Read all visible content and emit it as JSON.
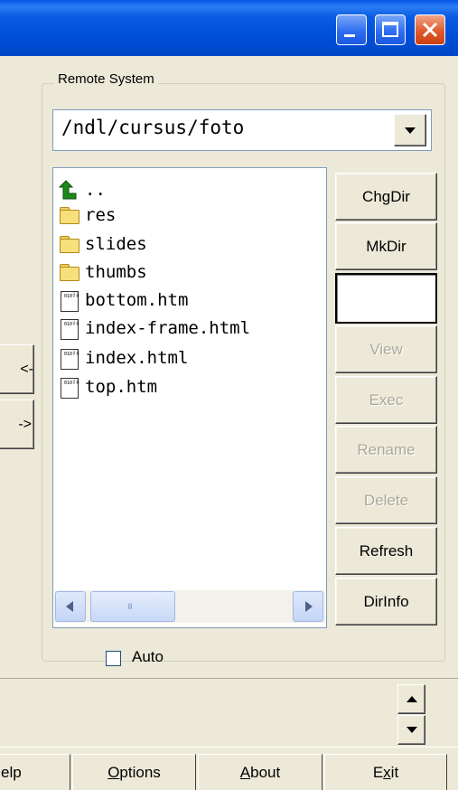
{
  "window": {
    "caption_buttons": [
      {
        "name": "minimize-icon"
      },
      {
        "name": "maximize-icon"
      },
      {
        "name": "close-icon"
      }
    ]
  },
  "remote": {
    "group_label": "Remote System",
    "path": "/ndl/cursus/foto",
    "files": [
      {
        "name": "..",
        "type": "up"
      },
      {
        "name": "res",
        "type": "folder"
      },
      {
        "name": "slides",
        "type": "folder"
      },
      {
        "name": "thumbs",
        "type": "folder"
      },
      {
        "name": "bottom.htm",
        "type": "file"
      },
      {
        "name": "index-frame.html",
        "type": "file"
      },
      {
        "name": "index.html",
        "type": "file"
      },
      {
        "name": "top.htm",
        "type": "file"
      }
    ],
    "scroll_grip": "III",
    "buttons": {
      "chgdir": "ChgDir",
      "mkdir": "MkDir",
      "view": "View",
      "exec": "Exec",
      "rename": "Rename",
      "delete": "Delete",
      "refresh": "Refresh",
      "dirinfo": "DirInfo"
    },
    "auto_label": "Auto",
    "auto_checked": false
  },
  "transfer": {
    "left_button": "<-",
    "right_button": "->"
  },
  "bottom": {
    "help_partial": "elp",
    "options_mn": "O",
    "options_rest": "ptions",
    "about_mn": "A",
    "about_rest": "bout",
    "exit_pre": "E",
    "exit_mn": "x",
    "exit_rest": "it"
  },
  "colors": {
    "titlebar": "#0054e3",
    "face": "#ece9d8",
    "disabled_text": "#aca899",
    "close": "#e05a2c"
  }
}
